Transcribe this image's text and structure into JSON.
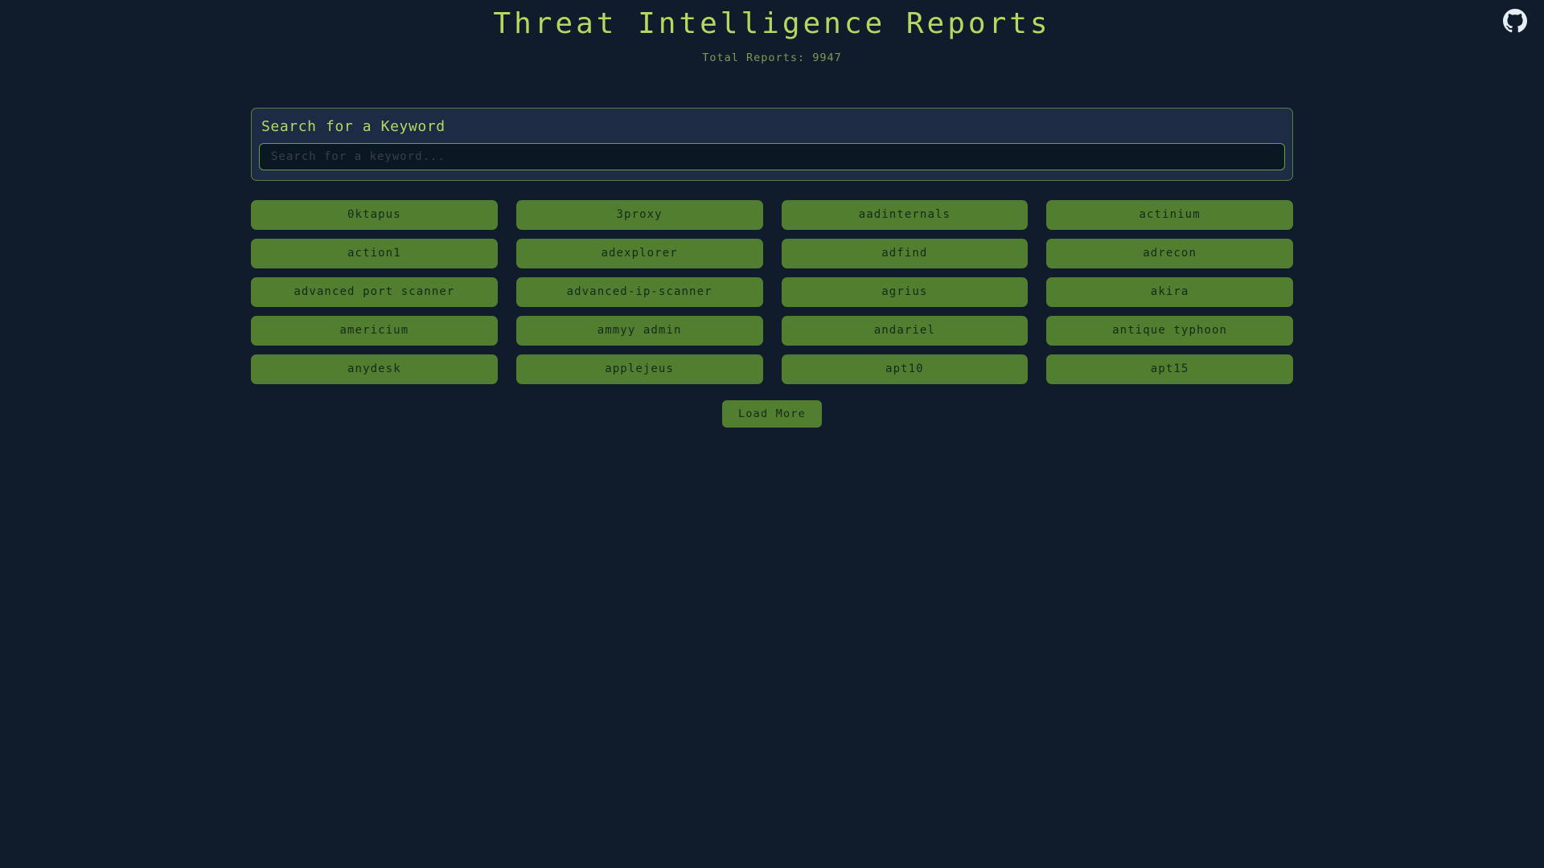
{
  "header": {
    "title": "Threat Intelligence Reports",
    "total_reports_text": "Total Reports: 9947",
    "total_reports_count": 9947,
    "github_icon": "github-icon",
    "title_color": "#b5d860",
    "subtitle_color": "#7e9b53",
    "background_color": "#101b2b"
  },
  "search": {
    "label": "Search for a Keyword",
    "placeholder": "Search for a keyword...",
    "value": "",
    "panel_background": "#1e2b44",
    "border_color": "#5d7a4d",
    "input_background": "#0a1822",
    "input_border_color": "#6f9d3e"
  },
  "keywords": {
    "button_color": "#527e2f",
    "button_text_color": "#16291c",
    "columns": 4,
    "items": [
      "0ktapus",
      "3proxy",
      "aadinternals",
      "actinium",
      "action1",
      "adexplorer",
      "adfind",
      "adrecon",
      "advanced port scanner",
      "advanced-ip-scanner",
      "agrius",
      "akira",
      "americium",
      "ammyy admin",
      "andariel",
      "antique typhoon",
      "anydesk",
      "applejeus",
      "apt10",
      "apt15"
    ]
  },
  "footer": {
    "load_more_label": "Load More"
  }
}
